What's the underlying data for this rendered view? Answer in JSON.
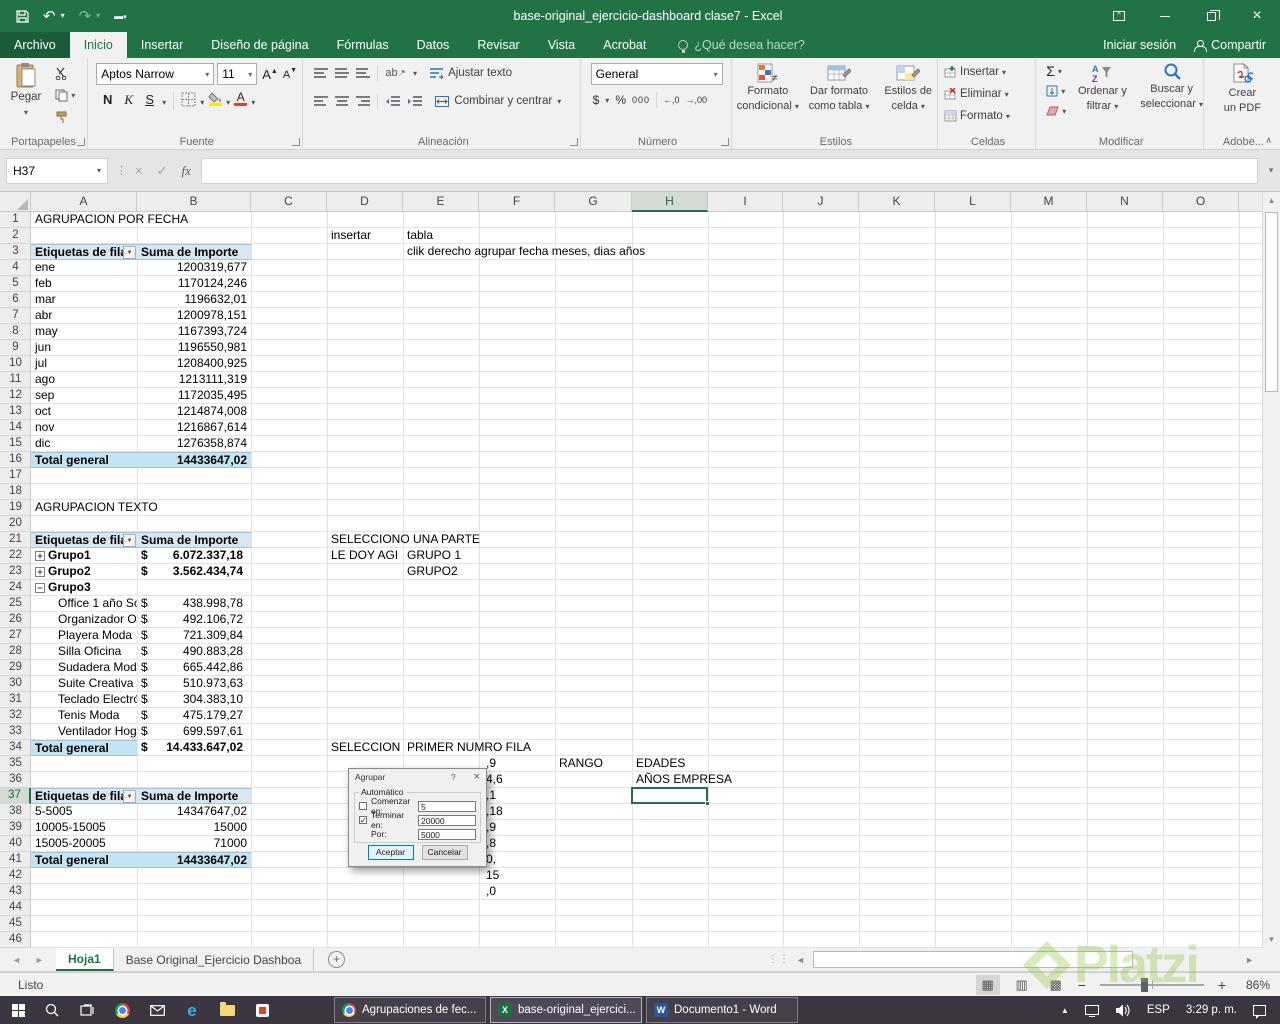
{
  "icons": {
    "dropdown": "▼",
    "caret": "▾",
    "undo": "↶",
    "redo": "↷",
    "close": "×",
    "check": "✓",
    "collapse": "∧",
    "fx": "fx",
    "sum": "Σ",
    "nav_left": "◄",
    "nav_right": "►",
    "scroll_up": "▲",
    "scroll_down": "▼",
    "tray_up": "▲",
    "add_sheet": "+",
    "view_normal": "▦",
    "view_layout": "▥",
    "view_break": "▩",
    "zoom_out": "−",
    "zoom_in": "+",
    "grip": "⋮⋮",
    "dots": "⋮",
    "dec_increase": "←,0",
    "dec_decrease": "→,00",
    "edge": "e",
    "word": "W",
    "excel": "X",
    "group_expand": "+",
    "group_collapse": "−"
  },
  "title_bar": {
    "title": "base-original_ejercicio-dashboard clase7 - Excel"
  },
  "ribbon": {
    "tabs": [
      "Archivo",
      "Inicio",
      "Insertar",
      "Diseño de página",
      "Fórmulas",
      "Datos",
      "Revisar",
      "Vista",
      "Acrobat"
    ],
    "active_tab": "Inicio",
    "search_hint": "¿Qué desea hacer?",
    "sign_in_label": "Iniciar sesión",
    "share_label": "Compartir",
    "clipboard": {
      "paste": "Pegar",
      "group": "Portapapeles"
    },
    "font": {
      "name": "Aptos Narrow",
      "size": "11",
      "bold": "N",
      "italic": "K",
      "underline": "S",
      "group": "Fuente"
    },
    "alignment": {
      "wrap": "Ajustar texto",
      "merge": "Combinar y centrar",
      "group": "Alineación"
    },
    "number": {
      "format": "General",
      "currency": "$",
      "percent": "%",
      "zeros": "000",
      "group": "Número"
    },
    "styles": {
      "conditional1": "Formato",
      "conditional2": "condicional",
      "table1": "Dar formato",
      "table2": "como tabla",
      "cell1": "Estilos de",
      "cell2": "celda",
      "group": "Estilos"
    },
    "cells": {
      "insert": "Insertar",
      "del": "Eliminar",
      "format": "Formato",
      "group": "Celdas"
    },
    "editing": {
      "sort1": "Ordenar y",
      "sort2": "filtrar",
      "find1": "Buscar y",
      "find2": "seleccionar",
      "group": "Modificar"
    },
    "adobe": {
      "pdf1": "Crear",
      "pdf2": "un PDF",
      "group": "Adobe..."
    }
  },
  "formula_bar": {
    "name_box": "H37",
    "formula": ""
  },
  "sheet": {
    "columns": [
      "A",
      "B",
      "C",
      "D",
      "E",
      "F",
      "G",
      "H",
      "I",
      "J",
      "K",
      "L",
      "M",
      "N",
      "O"
    ],
    "rows": 46,
    "selected_col": "H",
    "selected_row": 37,
    "selected_ref": "H37",
    "cells": [
      {
        "r": 1,
        "c": "A",
        "s": "text",
        "t": "AGRUPACION POR FECHA"
      },
      {
        "r": 2,
        "c": "D",
        "s": "text",
        "t": "insertar"
      },
      {
        "r": 2,
        "c": "E",
        "s": "text",
        "t": "tabla"
      },
      {
        "r": 3,
        "c": "A",
        "s": "ph",
        "d": 1,
        "t": "Etiquetas de fila"
      },
      {
        "r": 3,
        "c": "B",
        "s": "ph",
        "t": "Suma de Importe"
      },
      {
        "r": 3,
        "c": "E",
        "s": "text",
        "t": "clik derecho agrupar fecha meses, dias años"
      },
      {
        "r": 4,
        "c": "A",
        "s": "text",
        "t": "ene"
      },
      {
        "r": 4,
        "c": "B",
        "s": "num",
        "t": "1200319,677"
      },
      {
        "r": 5,
        "c": "A",
        "s": "text",
        "t": "feb"
      },
      {
        "r": 5,
        "c": "B",
        "s": "num",
        "t": "1170124,246"
      },
      {
        "r": 6,
        "c": "A",
        "s": "text",
        "t": "mar"
      },
      {
        "r": 6,
        "c": "B",
        "s": "num",
        "t": "1196632,01"
      },
      {
        "r": 7,
        "c": "A",
        "s": "text",
        "t": "abr"
      },
      {
        "r": 7,
        "c": "B",
        "s": "num",
        "t": "1200978,151"
      },
      {
        "r": 8,
        "c": "A",
        "s": "text",
        "t": "may"
      },
      {
        "r": 8,
        "c": "B",
        "s": "num",
        "t": "1167393,724"
      },
      {
        "r": 9,
        "c": "A",
        "s": "text",
        "t": "jun"
      },
      {
        "r": 9,
        "c": "B",
        "s": "num",
        "t": "1196550,981"
      },
      {
        "r": 10,
        "c": "A",
        "s": "text",
        "t": "jul"
      },
      {
        "r": 10,
        "c": "B",
        "s": "num",
        "t": "1208400,925"
      },
      {
        "r": 11,
        "c": "A",
        "s": "text",
        "t": "ago"
      },
      {
        "r": 11,
        "c": "B",
        "s": "num",
        "t": "1213111,319"
      },
      {
        "r": 12,
        "c": "A",
        "s": "text",
        "t": "sep"
      },
      {
        "r": 12,
        "c": "B",
        "s": "num",
        "t": "1172035,495"
      },
      {
        "r": 13,
        "c": "A",
        "s": "text",
        "t": "oct"
      },
      {
        "r": 13,
        "c": "B",
        "s": "num",
        "t": "1214874,008"
      },
      {
        "r": 14,
        "c": "A",
        "s": "text",
        "t": "nov"
      },
      {
        "r": 14,
        "c": "B",
        "s": "num",
        "t": "1216867,614"
      },
      {
        "r": 15,
        "c": "A",
        "s": "text",
        "t": "dic"
      },
      {
        "r": 15,
        "c": "B",
        "s": "num",
        "t": "1276358,874"
      },
      {
        "r": 16,
        "c": "A",
        "s": "totL",
        "t": "Total general"
      },
      {
        "r": 16,
        "c": "B",
        "s": "totN",
        "t": "14433647,02"
      },
      {
        "r": 19,
        "c": "A",
        "s": "text",
        "t": "AGRUPACION TEXTO"
      },
      {
        "r": 21,
        "c": "A",
        "s": "ph",
        "d": 1,
        "t": "Etiquetas de fila"
      },
      {
        "r": 21,
        "c": "B",
        "s": "ph",
        "t": "Suma de Importe"
      },
      {
        "r": 21,
        "c": "D",
        "s": "text",
        "t": "SELECCIONO UNA PARTE"
      },
      {
        "r": 22,
        "c": "A",
        "s": "grpP",
        "t": "Grupo1"
      },
      {
        "r": 22,
        "c": "B",
        "s": "accB",
        "t": [
          "$",
          "6.072.337,18"
        ]
      },
      {
        "r": 22,
        "c": "D",
        "s": "clip",
        "t": "LE DOY AGI"
      },
      {
        "r": 22,
        "c": "E",
        "s": "text",
        "t": "GRUPO 1"
      },
      {
        "r": 23,
        "c": "A",
        "s": "grpP",
        "t": "Grupo2"
      },
      {
        "r": 23,
        "c": "B",
        "s": "accB",
        "t": [
          "$",
          "3.562.434,74"
        ]
      },
      {
        "r": 23,
        "c": "E",
        "s": "text",
        "t": "GRUPO2"
      },
      {
        "r": 24,
        "c": "A",
        "s": "grpM",
        "t": "Grupo3"
      },
      {
        "r": 25,
        "c": "A",
        "s": "item",
        "t": "Office 1 año So"
      },
      {
        "r": 25,
        "c": "B",
        "s": "acc",
        "t": [
          "$",
          "438.998,78"
        ]
      },
      {
        "r": 26,
        "c": "A",
        "s": "item",
        "t": "Organizador Of"
      },
      {
        "r": 26,
        "c": "B",
        "s": "acc",
        "t": [
          "$",
          "492.106,72"
        ]
      },
      {
        "r": 27,
        "c": "A",
        "s": "item",
        "t": "Playera Moda"
      },
      {
        "r": 27,
        "c": "B",
        "s": "acc",
        "t": [
          "$",
          "721.309,84"
        ]
      },
      {
        "r": 28,
        "c": "A",
        "s": "item",
        "t": "Silla Oficina"
      },
      {
        "r": 28,
        "c": "B",
        "s": "acc",
        "t": [
          "$",
          "490.883,28"
        ]
      },
      {
        "r": 29,
        "c": "A",
        "s": "item",
        "t": "Sudadera Moda"
      },
      {
        "r": 29,
        "c": "B",
        "s": "acc",
        "t": [
          "$",
          "665.442,86"
        ]
      },
      {
        "r": 30,
        "c": "A",
        "s": "item",
        "t": "Suite Creativa S"
      },
      {
        "r": 30,
        "c": "B",
        "s": "acc",
        "t": [
          "$",
          "510.973,63"
        ]
      },
      {
        "r": 31,
        "c": "A",
        "s": "item",
        "t": "Teclado Electró"
      },
      {
        "r": 31,
        "c": "B",
        "s": "acc",
        "t": [
          "$",
          "304.383,10"
        ]
      },
      {
        "r": 32,
        "c": "A",
        "s": "item",
        "t": "Tenis Moda"
      },
      {
        "r": 32,
        "c": "B",
        "s": "acc",
        "t": [
          "$",
          "475.179,27"
        ]
      },
      {
        "r": 33,
        "c": "A",
        "s": "item",
        "t": "Ventilador Hoga"
      },
      {
        "r": 33,
        "c": "B",
        "s": "acc",
        "t": [
          "$",
          "699.597,61"
        ]
      },
      {
        "r": 34,
        "c": "A",
        "s": "totL",
        "t": "Total general"
      },
      {
        "r": 34,
        "c": "B",
        "s": "accT",
        "t": [
          "$",
          "14.433.647,02"
        ]
      },
      {
        "r": 34,
        "c": "D",
        "s": "clip",
        "t": "SELECCION"
      },
      {
        "r": 34,
        "c": "E",
        "s": "text",
        "t": "PRIMER  NUMRO FILA"
      },
      {
        "r": 35,
        "c": "F",
        "s": "frag",
        "t": ",9"
      },
      {
        "r": 35,
        "c": "G",
        "s": "text",
        "t": "RANGO"
      },
      {
        "r": 35,
        "c": "H",
        "s": "text",
        "t": "EDADES"
      },
      {
        "r": 36,
        "c": "F",
        "s": "frag",
        "t": "4,6"
      },
      {
        "r": 36,
        "c": "H",
        "s": "text",
        "t": "AÑOS EMPRESA"
      },
      {
        "r": 37,
        "c": "A",
        "s": "ph",
        "d": 1,
        "t": "Etiquetas de fila"
      },
      {
        "r": 37,
        "c": "B",
        "s": "ph",
        "t": "Suma de Importe"
      },
      {
        "r": 37,
        "c": "F",
        "s": "frag",
        "t": ",1"
      },
      {
        "r": 38,
        "c": "A",
        "s": "text",
        "t": "5-5005"
      },
      {
        "r": 38,
        "c": "B",
        "s": "num",
        "t": "14347647,02"
      },
      {
        "r": 38,
        "c": "F",
        "s": "frag",
        "t": ",18"
      },
      {
        "r": 39,
        "c": "A",
        "s": "text",
        "t": "10005-15005"
      },
      {
        "r": 39,
        "c": "B",
        "s": "num",
        "t": "15000"
      },
      {
        "r": 39,
        "c": "F",
        "s": "frag",
        "t": ",9"
      },
      {
        "r": 40,
        "c": "A",
        "s": "text",
        "t": "15005-20005"
      },
      {
        "r": 40,
        "c": "B",
        "s": "num",
        "t": "71000"
      },
      {
        "r": 40,
        "c": "F",
        "s": "frag",
        "t": ",8"
      },
      {
        "r": 41,
        "c": "A",
        "s": "totL",
        "t": "Total general"
      },
      {
        "r": 41,
        "c": "B",
        "s": "totN",
        "t": "14433647,02"
      },
      {
        "r": 41,
        "c": "F",
        "s": "frag",
        "t": "0,"
      },
      {
        "r": 42,
        "c": "F",
        "s": "frag",
        "t": "15"
      },
      {
        "r": 43,
        "c": "F",
        "s": "frag",
        "t": ",0"
      }
    ]
  },
  "dialog": {
    "title": "Agrupar",
    "help": "?",
    "section": "Automático",
    "fields": [
      {
        "label": "Comenzar en:",
        "value": "5",
        "checked": false
      },
      {
        "label": "Terminar en:",
        "value": "20000",
        "checked": true
      },
      {
        "label": "Por:",
        "value": "5000",
        "checked": null
      }
    ],
    "ok": "Aceptar",
    "cancel": "Cancelar"
  },
  "sheet_tabs": {
    "tabs": [
      "Hoja1",
      "Base Original_Ejercicio Dashboa"
    ],
    "active": "Hoja1"
  },
  "status_bar": {
    "ready": "Listo",
    "zoom": "86%"
  },
  "taskbar": {
    "buttons": [
      {
        "label": "Agrupaciones de fec...",
        "app": "chrome",
        "active": false
      },
      {
        "label": "base-original_ejercici...",
        "app": "excel",
        "active": true
      },
      {
        "label": "Documento1 - Word",
        "app": "word",
        "active": false
      }
    ],
    "lang": "ESP",
    "time": "3:29 p. m."
  },
  "watermark": {
    "text": "Platzi"
  }
}
